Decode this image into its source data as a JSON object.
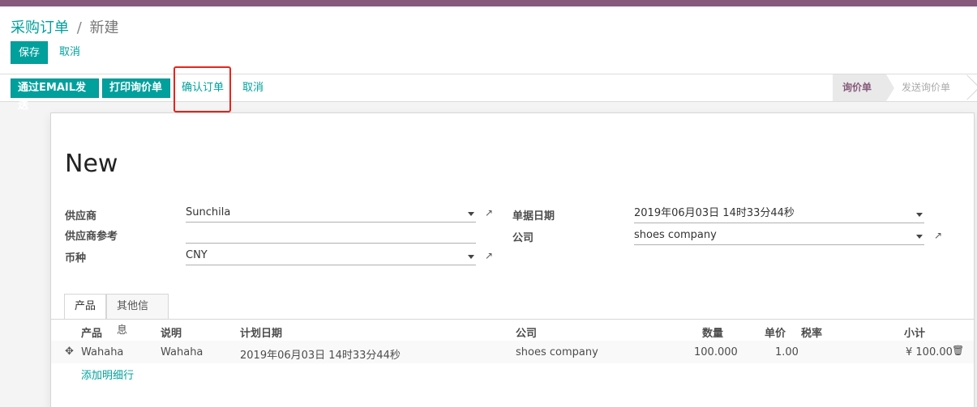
{
  "breadcrumb": {
    "parent": "采购订单",
    "separator": "/",
    "current": "新建"
  },
  "control": {
    "save_label": "保存",
    "discard_label": "取消"
  },
  "header_buttons": {
    "email_label": "通过EMAIL发送",
    "print_label": "打印询价单",
    "confirm_label": "确认订单",
    "cancel_label": "取消"
  },
  "statusbar": {
    "stages": [
      "询价单",
      "发送询价单"
    ],
    "active_index": 0
  },
  "form": {
    "title": "New",
    "fields": {
      "vendor_label": "供应商",
      "vendor_value": "Sunchila",
      "vendor_ref_label": "供应商参考",
      "vendor_ref_value": "",
      "currency_label": "币种",
      "currency_value": "CNY",
      "order_date_label": "单据日期",
      "order_date_value": "2019年06月03日 14时33分44秒",
      "company_label": "公司",
      "company_value": "shoes company"
    },
    "tabs": [
      "产品",
      "其他信息"
    ],
    "table": {
      "headers": [
        "产品",
        "说明",
        "计划日期",
        "公司",
        "数量",
        "单价",
        "税率",
        "小计"
      ],
      "rows": [
        {
          "product": "Wahaha",
          "description": "Wahaha",
          "date_planned": "2019年06月03日 14时33分44秒",
          "company": "shoes company",
          "qty": "100.000",
          "price_unit": "1.00",
          "taxes": "",
          "subtotal": "¥ 100.00"
        }
      ],
      "add_line_label": "添加明细行"
    }
  },
  "colors": {
    "primary": "#00a09d",
    "brand": "#875a7b",
    "highlight": "#e8241b"
  },
  "icons": {
    "external_link": "external-link-icon",
    "drag_handle": "drag-handle-icon",
    "trash": "trash-icon"
  }
}
